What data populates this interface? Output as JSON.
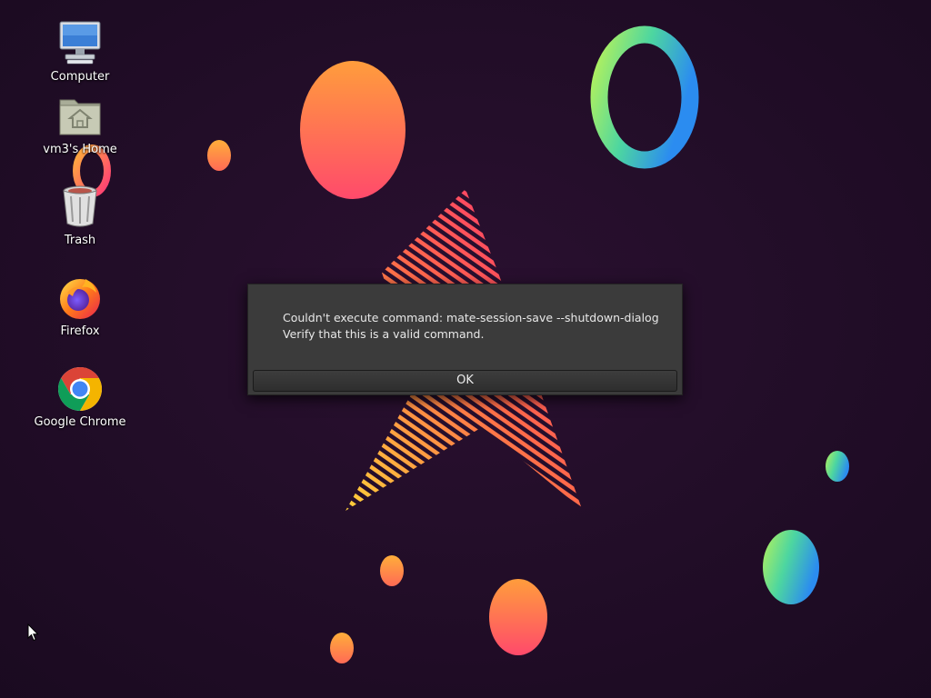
{
  "desktop": {
    "icons": [
      {
        "label": "Computer",
        "icon": "computer-icon"
      },
      {
        "label": "vm3's Home",
        "icon": "home-folder-icon"
      },
      {
        "label": "Trash",
        "icon": "trash-icon"
      },
      {
        "label": "Firefox",
        "icon": "firefox-icon"
      },
      {
        "label": "Google Chrome",
        "icon": "chrome-icon"
      }
    ]
  },
  "dialog": {
    "message_line1": "Couldn't execute command: mate-session-save --shutdown-dialog",
    "message_line2": "Verify that this is a valid command.",
    "ok_label": "OK"
  },
  "colors": {
    "background": "#1f0d26",
    "dialog_bg": "#3b3b3b",
    "dialog_text": "#e8e8e8"
  }
}
